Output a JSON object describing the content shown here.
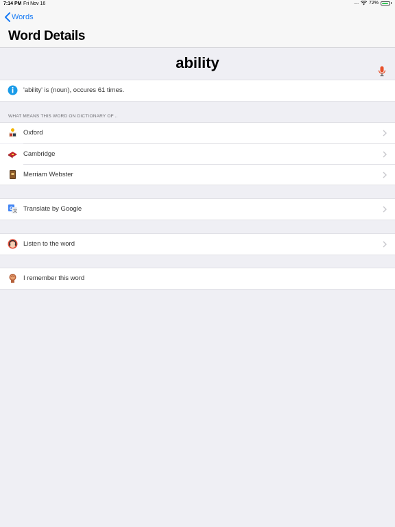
{
  "status": {
    "time": "7:14 PM",
    "date": "Fri Nov 16",
    "signal": ".....",
    "battery": "72%"
  },
  "nav": {
    "back_label": "Words",
    "title": "Word Details"
  },
  "word": {
    "text": "ability"
  },
  "info": {
    "text": "'ability' is (noun), occures 61 times."
  },
  "dictionary_section": {
    "header": "WHAT MEANS THIS WORD ON DICTIONARY OF ..",
    "items": [
      {
        "label": "Oxford",
        "icon": "oxford-icon"
      },
      {
        "label": "Cambridge",
        "icon": "cambridge-icon"
      },
      {
        "label": "Merriam Webster",
        "icon": "merriam-webster-icon"
      }
    ]
  },
  "translate": {
    "label": "Translate by Google",
    "icon": "google-translate-icon"
  },
  "listen": {
    "label": "Listen to the word",
    "icon": "listen-icon"
  },
  "remember": {
    "label": "I remember this word",
    "icon": "brain-icon"
  },
  "colors": {
    "accent": "#1a7cf5",
    "mic": "#e8502a",
    "background": "#efeff4"
  }
}
